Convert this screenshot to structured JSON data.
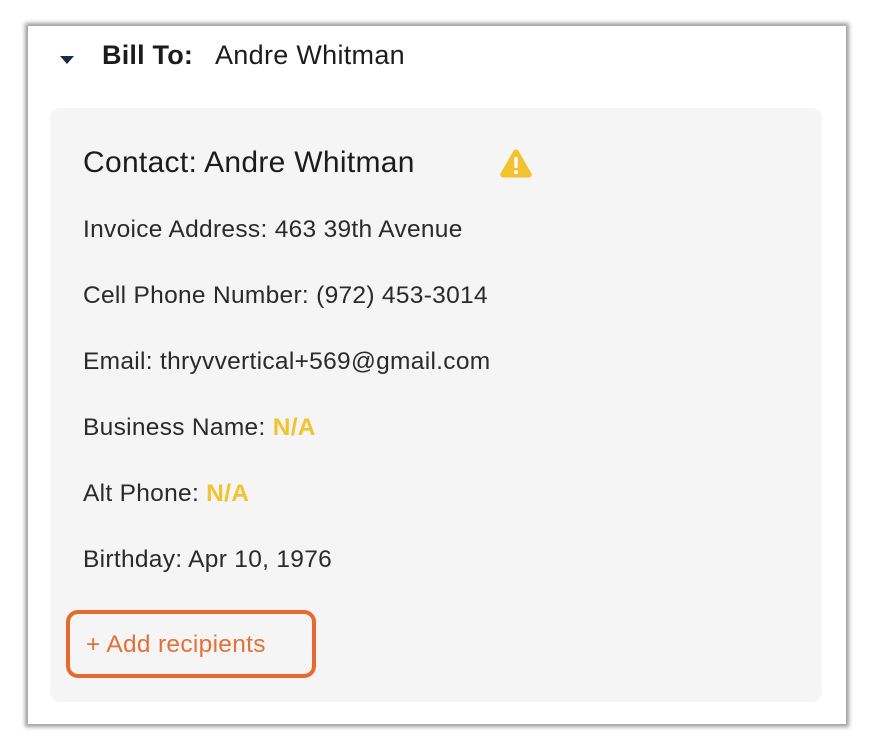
{
  "bill_to": {
    "label": "Bill To:",
    "name": "Andre Whitman"
  },
  "contact": {
    "title": "Contact: Andre Whitman",
    "warning_icon": "warning-triangle-icon",
    "warning_color": "#f2c230",
    "fields": {
      "invoice_address": {
        "label": "Invoice Address:",
        "value": "463 39th Avenue"
      },
      "cell_phone": {
        "label": "Cell Phone Number:",
        "value": "(972) 453-3014"
      },
      "email": {
        "label": "Email:",
        "value": "thryvvertical+569@gmail.com"
      },
      "business_name": {
        "label": "Business Name:",
        "value": "N/A"
      },
      "alt_phone": {
        "label": "Alt Phone:",
        "value": "N/A"
      },
      "birthday": {
        "label": "Birthday:",
        "value": "Apr 10, 1976"
      }
    }
  },
  "actions": {
    "add_recipients": "+ Add recipients"
  },
  "colors": {
    "na_highlight": "#f2c230",
    "add_recipients_accent": "#e66a2f",
    "card_background": "#f5f5f5",
    "caret": "#1b2a4a"
  }
}
